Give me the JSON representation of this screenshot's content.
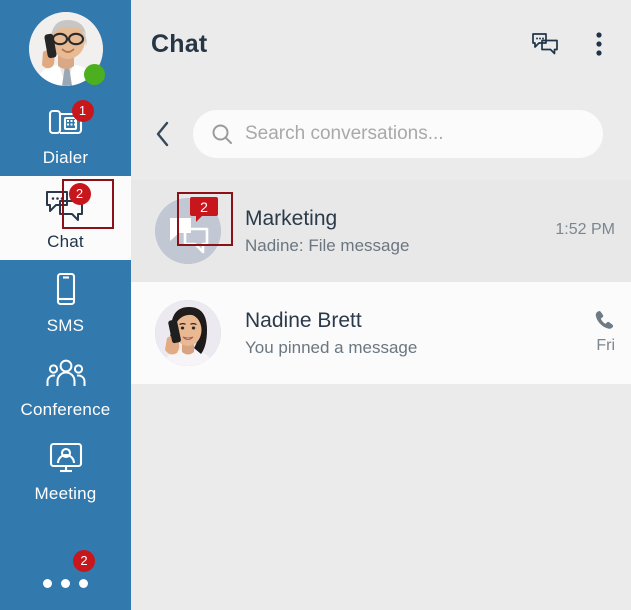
{
  "colors": {
    "sidebar_blue": "#3279ae",
    "badge_red": "#c8161d",
    "highlight_box": "#8c1018",
    "status_green": "#4caf1f",
    "panel_bg": "#ebebeb",
    "row_unread_bg": "#e8e8e8",
    "row_read_bg": "#fbfbfb",
    "title_text": "#263645"
  },
  "sidebar": {
    "user_avatar": {
      "name": "user-avatar",
      "icon": "person-photo",
      "status": "online"
    },
    "items": [
      {
        "label": "Dialer",
        "icon": "desk-phone-icon",
        "badge": "1",
        "active": false
      },
      {
        "label": "Chat",
        "icon": "chat-bubbles-icon",
        "badge": "2",
        "active": true
      },
      {
        "label": "SMS",
        "icon": "mobile-phone-icon",
        "badge": "",
        "active": false
      },
      {
        "label": "Conference",
        "icon": "people-group-icon",
        "badge": "",
        "active": false
      },
      {
        "label": "Meeting",
        "icon": "screen-person-icon",
        "badge": "",
        "active": false
      }
    ],
    "more": {
      "icon": "three-dots-icon",
      "dots": 3,
      "badge": "2"
    }
  },
  "header": {
    "title": "Chat",
    "new_chat_icon": "new-conversation-icon",
    "menu_icon": "vertical-dots-icon"
  },
  "search": {
    "back_icon": "chevron-left-icon",
    "search_icon": "search-icon",
    "value": "",
    "placeholder": "Search conversations..."
  },
  "conversations": [
    {
      "name": "Marketing",
      "preview": "Nadine: File message",
      "time": "1:52 PM",
      "badge": "2",
      "avatar_type": "group-chat-bubbles",
      "unread": true,
      "call_icon": ""
    },
    {
      "name": "Nadine Brett",
      "preview": "You pinned a message",
      "time": "Fri",
      "badge": "",
      "avatar_type": "person-photo",
      "unread": false,
      "call_icon": "phone-icon"
    }
  ]
}
